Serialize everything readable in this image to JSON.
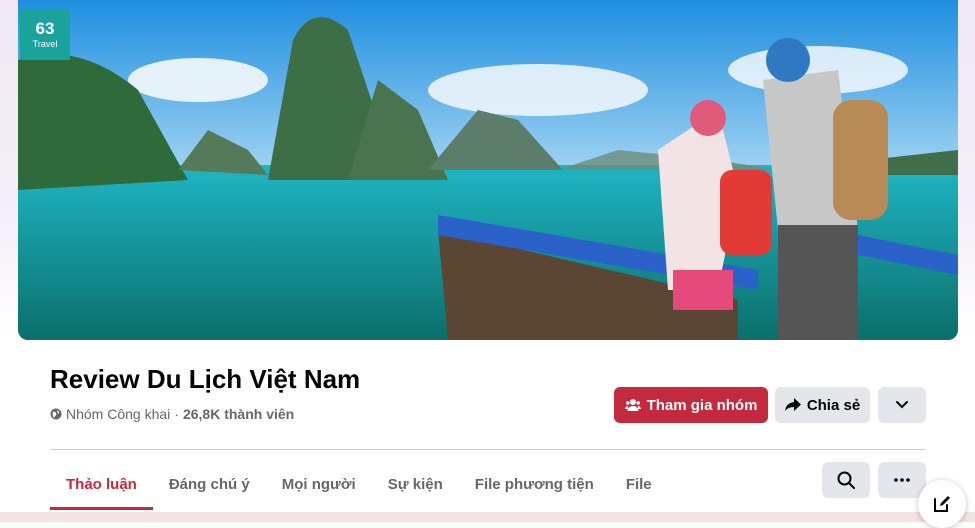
{
  "logo": {
    "number": "63",
    "text": "Travel"
  },
  "group": {
    "name": "Review Du Lịch Việt Nam",
    "privacy": "Nhóm Công khai",
    "separator": "·",
    "members": "26,8K thành viên"
  },
  "actions": {
    "join_label": "Tham gia nhóm",
    "share_label": "Chia sẻ"
  },
  "tabs": [
    {
      "label": "Thảo luận",
      "active": true
    },
    {
      "label": "Đáng chú ý"
    },
    {
      "label": "Mọi người"
    },
    {
      "label": "Sự kiện"
    },
    {
      "label": "File phương tiện"
    },
    {
      "label": "File"
    }
  ],
  "icons": {
    "join": "people-icon",
    "share": "share-arrow-icon",
    "more": "chevron-down-icon",
    "search": "search-icon",
    "dots": "more-dots-icon",
    "compose": "compose-icon",
    "privacy": "globe-icon"
  },
  "colors": {
    "accent": "#c5293d",
    "secondary_button": "#e4e6eb",
    "logo_bg": "#1aa39a"
  }
}
